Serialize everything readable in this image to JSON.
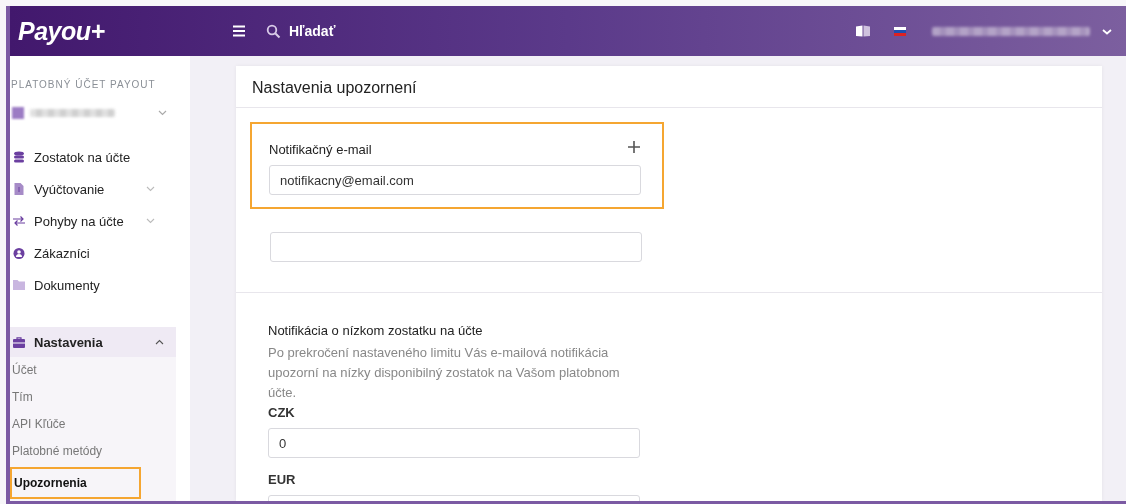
{
  "header": {
    "logo": "Payou+",
    "search": {
      "placeholder": "Hľadať"
    }
  },
  "sidebar": {
    "section_label": "PLATOBNÝ ÚČET PAYOUT",
    "items": [
      {
        "label": "Zostatok na účte",
        "kind": "coins",
        "expandable": false
      },
      {
        "label": "Vyúčtovanie",
        "kind": "invoice",
        "expandable": true
      },
      {
        "label": "Pohyby na účte",
        "kind": "transfer",
        "expandable": true
      },
      {
        "label": "Zákazníci",
        "kind": "person",
        "expandable": false
      },
      {
        "label": "Dokumenty",
        "kind": "folder",
        "expandable": false
      }
    ],
    "group": {
      "label": "Nastavenia",
      "expanded": true,
      "children": [
        {
          "label": "Účet",
          "selected": false
        },
        {
          "label": "Tím",
          "selected": false
        },
        {
          "label": "API Kľúče",
          "selected": false
        },
        {
          "label": "Platobné metódy",
          "selected": false
        },
        {
          "label": "Upozornenia",
          "selected": true
        }
      ]
    }
  },
  "page": {
    "title": "Nastavenia upozornení",
    "email_section": {
      "label": "Notifikačný e-mail",
      "fields": [
        {
          "value": "notifikacny@email.com",
          "highlighted": true
        },
        {
          "highlighted": false
        }
      ]
    },
    "balance_section": {
      "title": "Notifikácia o nízkom zostatku na účte",
      "description": "Po prekročení nastaveného limitu Vás e-mailová notifikácia upozorní na nízky disponibilný zostatok na Vašom platobnom účte.",
      "currencies": [
        {
          "label": "CZK",
          "value": "0"
        },
        {
          "label": "EUR"
        }
      ]
    }
  }
}
